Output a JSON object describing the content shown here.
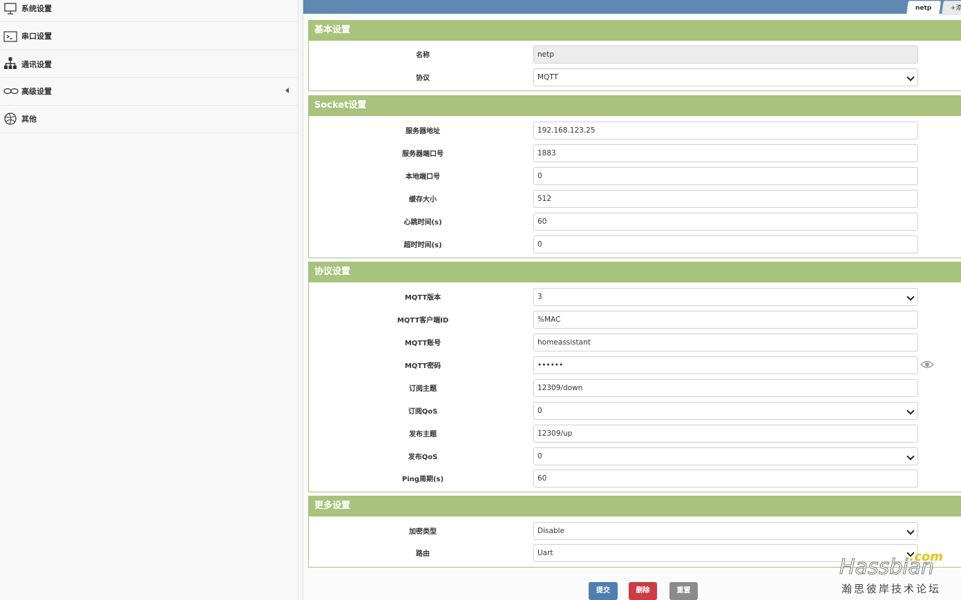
{
  "sidebar": {
    "items": [
      {
        "label": "系统设置",
        "icon": "monitor-icon"
      },
      {
        "label": "串口设置",
        "icon": "terminal-icon"
      },
      {
        "label": "通讯设置",
        "icon": "network-icon"
      },
      {
        "label": "高级设置",
        "icon": "infinity-icon"
      },
      {
        "label": "其他",
        "icon": "globe-icon"
      }
    ]
  },
  "tabs": {
    "active": "netp",
    "add": "+添"
  },
  "sections": {
    "basic": {
      "title": "基本设置",
      "name_label": "名称",
      "name_value": "netp",
      "protocol_label": "协议",
      "protocol_value": "MQTT"
    },
    "socket": {
      "title": "Socket设置",
      "server_addr_label": "服务器地址",
      "server_addr_value": "192.168.123.25",
      "server_port_label": "服务器端口号",
      "server_port_value": "1883",
      "local_port_label": "本地端口号",
      "local_port_value": "0",
      "buffer_label": "缓存大小",
      "buffer_value": "512",
      "heartbeat_label": "心跳时间(s)",
      "heartbeat_value": "60",
      "timeout_label": "超时时间(s)",
      "timeout_value": "0"
    },
    "protocol": {
      "title": "协议设置",
      "version_label": "MQTT版本",
      "version_value": "3",
      "client_id_label": "MQTT客户端ID",
      "client_id_value": "%MAC",
      "account_label": "MQTT账号",
      "account_value": "homeassistant",
      "password_label": "MQTT密码",
      "password_value": "••••••",
      "sub_topic_label": "订阅主题",
      "sub_topic_value": "12309/down",
      "sub_qos_label": "订阅QoS",
      "sub_qos_value": "0",
      "pub_topic_label": "发布主题",
      "pub_topic_value": "12309/up",
      "pub_qos_label": "发布QoS",
      "pub_qos_value": "0",
      "ping_label": "Ping周期(s)",
      "ping_value": "60"
    },
    "more": {
      "title": "更多设置",
      "encrypt_label": "加密类型",
      "encrypt_value": "Disable",
      "route_label": "路由",
      "route_value": "Uart"
    }
  },
  "buttons": {
    "submit": "提交",
    "delete": "删除",
    "reset": "重置"
  },
  "watermark": {
    "brand": "Hassbian",
    "com": ".com",
    "sub": "瀚思彼岸技术论坛"
  },
  "colors": {
    "accent_header": "#a7c37c",
    "topbar": "#6189b0",
    "submit": "#4e7fae",
    "delete": "#cc3c45",
    "reset": "#8b8b8b"
  }
}
